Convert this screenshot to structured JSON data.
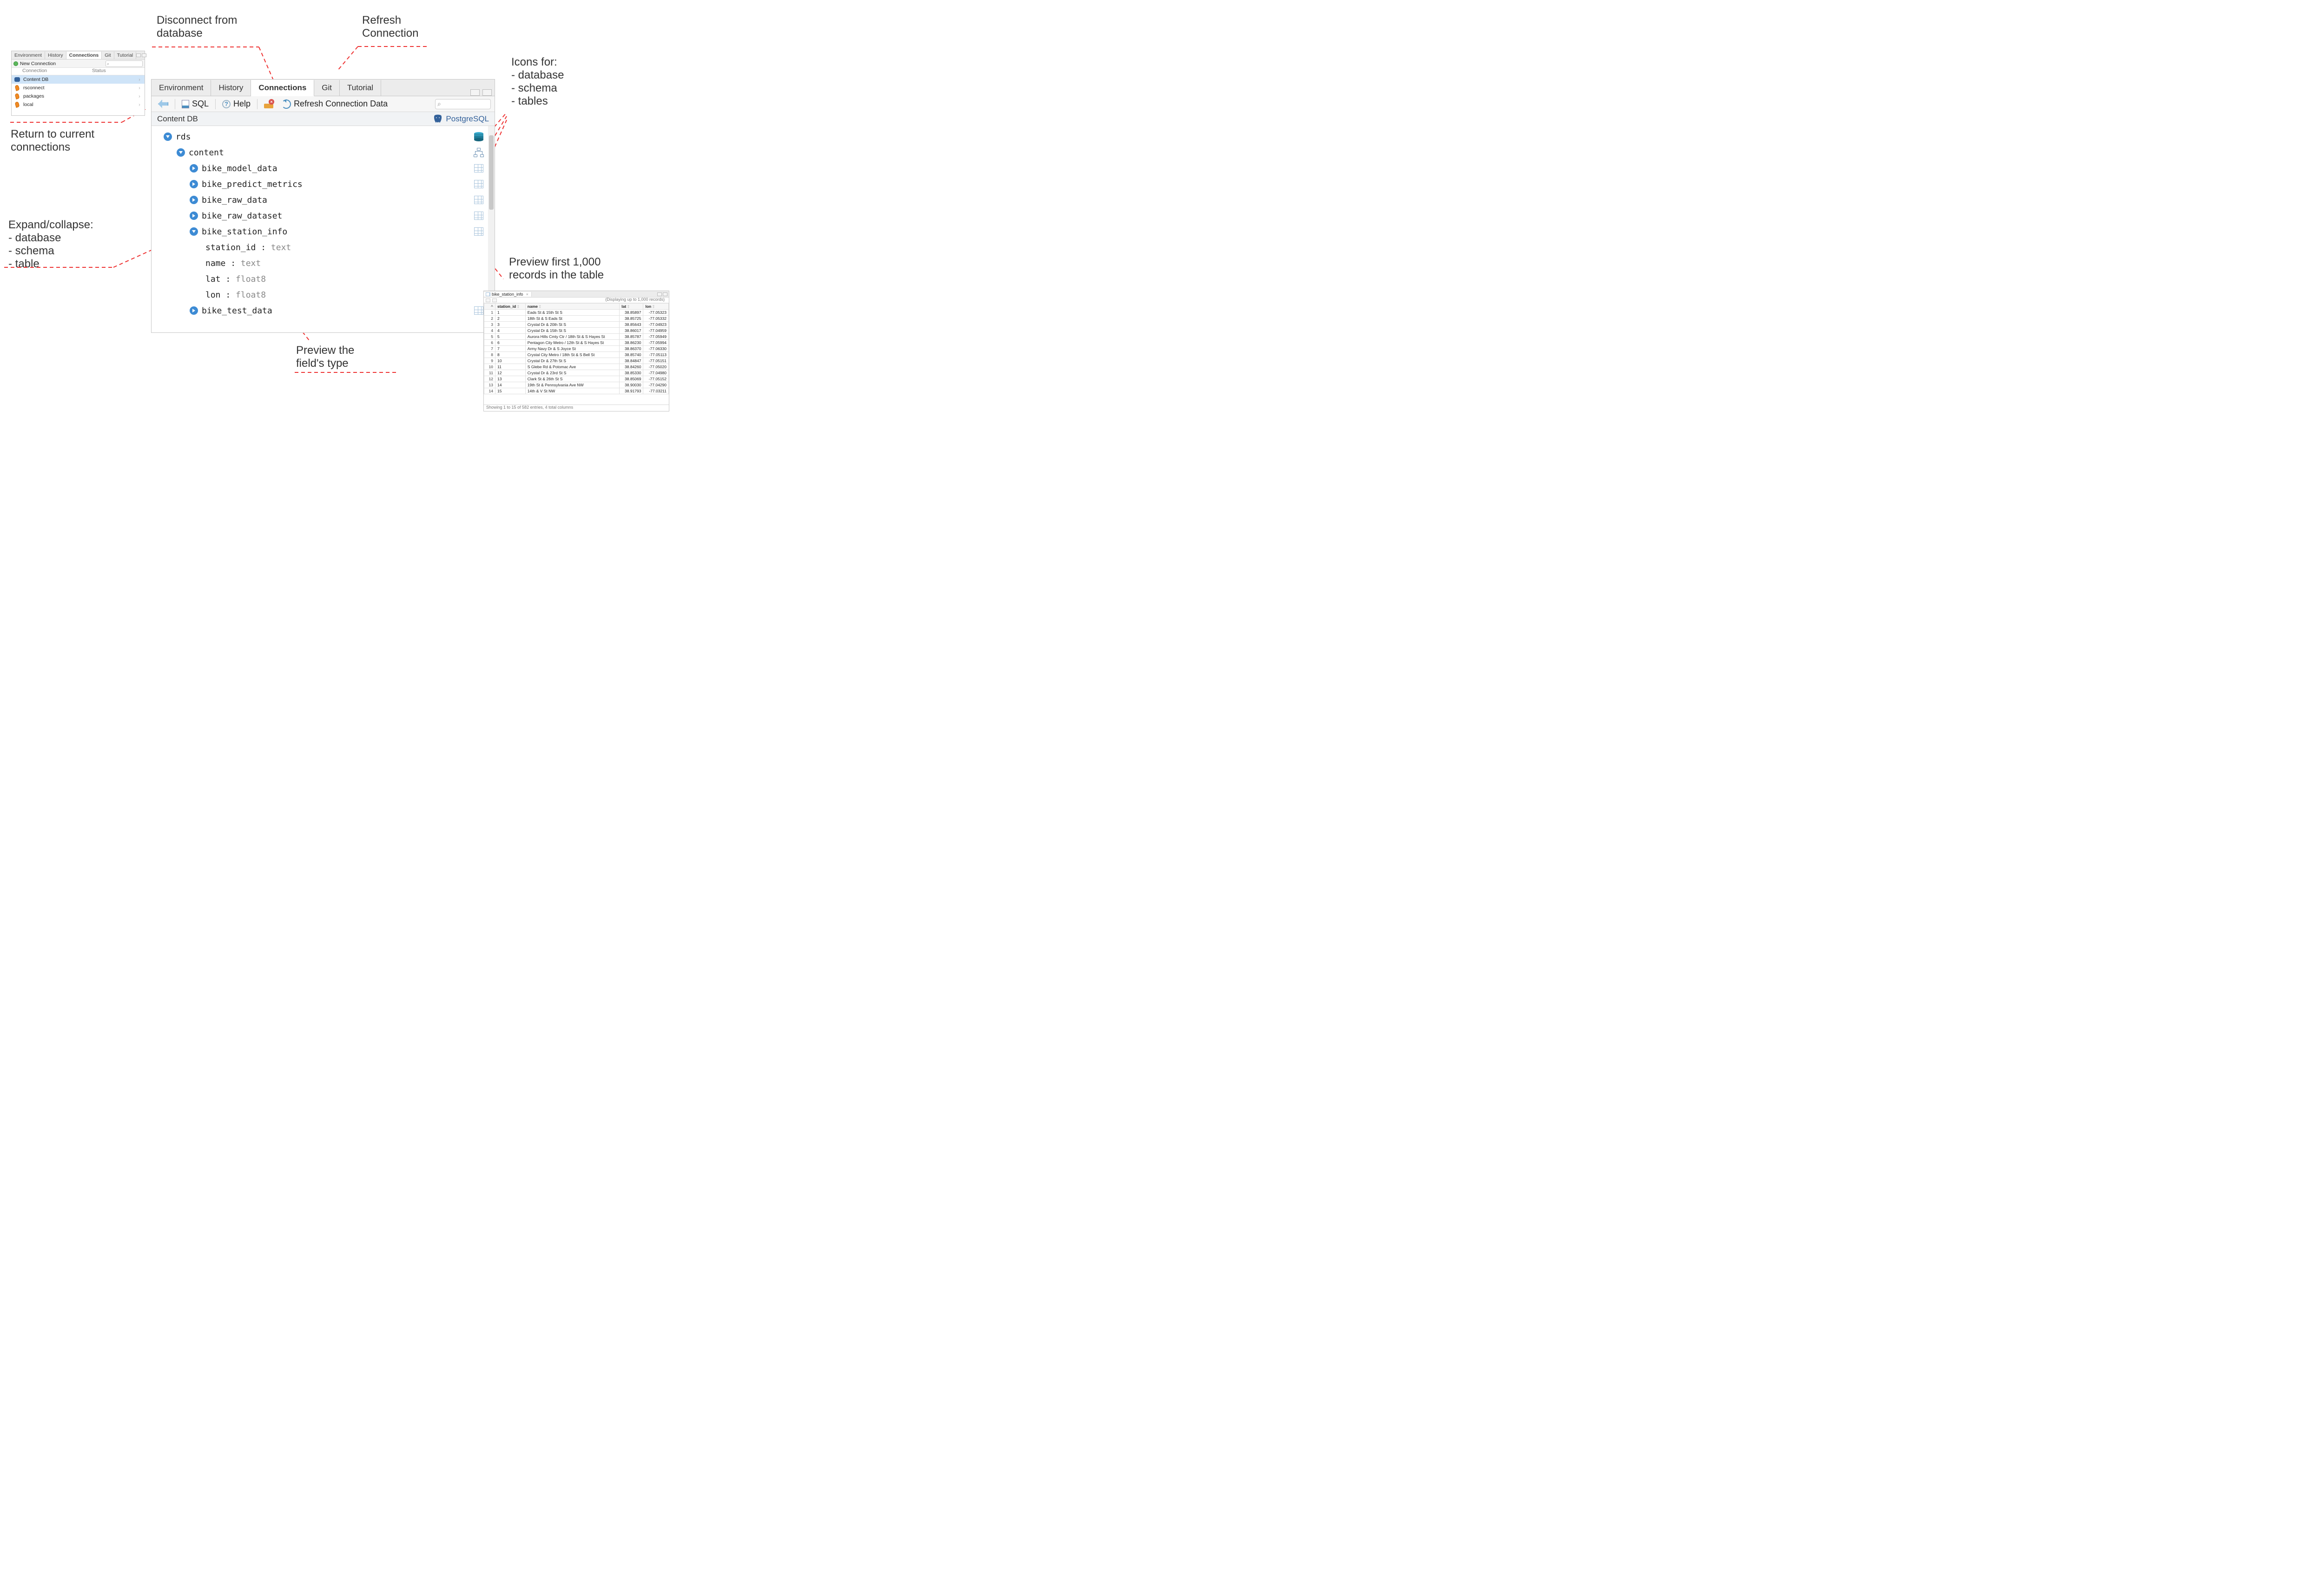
{
  "callouts": {
    "disconnect": "Disconnect from\ndatabase",
    "refresh": "Refresh\nConnection",
    "return_to": "Return to current\nconnections",
    "icons_for": "Icons for:\n- database\n- schema\n- tables",
    "expand": "Expand/collapse:\n- database\n- schema\n- table",
    "field_type": "Preview the\nfield's type",
    "preview1000": "Preview first 1,000\nrecords in the table"
  },
  "small_panel": {
    "tabs": [
      "Environment",
      "History",
      "Connections",
      "Git",
      "Tutorial"
    ],
    "active_tab": "Connections",
    "new_connection": "New Connection",
    "headers": {
      "connection": "Connection",
      "status": "Status"
    },
    "rows": [
      {
        "name": "Content DB",
        "icon": "elephant",
        "selected": true
      },
      {
        "name": "rsconnect",
        "icon": "pin",
        "selected": false
      },
      {
        "name": "packages",
        "icon": "pin",
        "selected": false
      },
      {
        "name": "local",
        "icon": "pin",
        "selected": false
      }
    ]
  },
  "main_pane": {
    "tabs": [
      "Environment",
      "History",
      "Connections",
      "Git",
      "Tutorial"
    ],
    "active_tab": "Connections",
    "toolbar": {
      "sql": "SQL",
      "help": "Help",
      "refresh": "Refresh Connection Data"
    },
    "db_name": "Content DB",
    "db_engine": "PostgreSQL",
    "tree": {
      "database": "rds",
      "schema": "content",
      "tables": [
        {
          "name": "bike_model_data",
          "expanded": false
        },
        {
          "name": "bike_predict_metrics",
          "expanded": false
        },
        {
          "name": "bike_raw_data",
          "expanded": false
        },
        {
          "name": "bike_raw_dataset",
          "expanded": false
        },
        {
          "name": "bike_station_info",
          "expanded": true,
          "fields": [
            {
              "name": "station_id",
              "type": "text"
            },
            {
              "name": "name",
              "type": "text"
            },
            {
              "name": "lat",
              "type": "float8"
            },
            {
              "name": "lon",
              "type": "float8"
            }
          ]
        },
        {
          "name": "bike_test_data",
          "expanded": false
        }
      ]
    }
  },
  "preview": {
    "tab_title": "bike_station_info",
    "note": "(Displaying up to 1,000 records)",
    "columns": [
      "station_id",
      "name",
      "lat",
      "lon"
    ],
    "footer": "Showing 1 to 15 of 582 entries, 4 total columns",
    "rows": [
      {
        "i": 1,
        "station_id": "1",
        "name": "Eads St & 15th St S",
        "lat": "38.85897",
        "lon": "-77.05323"
      },
      {
        "i": 2,
        "station_id": "2",
        "name": "18th St & S Eads St",
        "lat": "38.85725",
        "lon": "-77.05332"
      },
      {
        "i": 3,
        "station_id": "3",
        "name": "Crystal Dr & 20th St S",
        "lat": "38.85643",
        "lon": "-77.04923"
      },
      {
        "i": 4,
        "station_id": "4",
        "name": "Crystal Dr & 15th St S",
        "lat": "38.86017",
        "lon": "-77.04959"
      },
      {
        "i": 5,
        "station_id": "5",
        "name": "Aurora Hills Cmty Ctr / 18th St & S Hayes St",
        "lat": "38.85787",
        "lon": "-77.05949"
      },
      {
        "i": 6,
        "station_id": "6",
        "name": "Pentagon City Metro / 12th St & S Hayes St",
        "lat": "38.86230",
        "lon": "-77.05994"
      },
      {
        "i": 7,
        "station_id": "7",
        "name": "Army Navy Dr & S Joyce St",
        "lat": "38.86370",
        "lon": "-77.06330"
      },
      {
        "i": 8,
        "station_id": "8",
        "name": "Crystal City Metro / 18th St & S Bell St",
        "lat": "38.85740",
        "lon": "-77.05113"
      },
      {
        "i": 9,
        "station_id": "10",
        "name": "Crystal Dr & 27th St S",
        "lat": "38.84847",
        "lon": "-77.05151"
      },
      {
        "i": 10,
        "station_id": "11",
        "name": "S Glebe Rd & Potomac Ave",
        "lat": "38.84260",
        "lon": "-77.05020"
      },
      {
        "i": 11,
        "station_id": "12",
        "name": "Crystal Dr & 23rd St S",
        "lat": "38.85330",
        "lon": "-77.04980"
      },
      {
        "i": 12,
        "station_id": "13",
        "name": "Clark St & 26th St S",
        "lat": "38.85069",
        "lon": "-77.05152"
      },
      {
        "i": 13,
        "station_id": "14",
        "name": "19th St & Pennsylvania Ave NW",
        "lat": "38.90030",
        "lon": "-77.04290"
      },
      {
        "i": 14,
        "station_id": "15",
        "name": "14th & V St NW",
        "lat": "38.91793",
        "lon": "-77.03211"
      }
    ]
  }
}
